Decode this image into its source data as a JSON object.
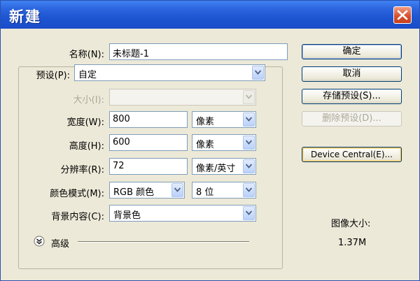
{
  "window": {
    "title": "新建"
  },
  "form": {
    "name_label": "名称(N):",
    "name_value": "未标题-1",
    "preset_label": "预设(P):",
    "preset_value": "自定",
    "size_label": "大小(I):",
    "size_value": "",
    "width_label": "宽度(W):",
    "width_value": "800",
    "width_unit": "像素",
    "height_label": "高度(H):",
    "height_value": "600",
    "height_unit": "像素",
    "resolution_label": "分辨率(R):",
    "resolution_value": "72",
    "resolution_unit": "像素/英寸",
    "color_mode_label": "颜色模式(M):",
    "color_mode_value": "RGB 颜色",
    "bit_depth_value": "8 位",
    "background_label": "背景内容(C):",
    "background_value": "背景色",
    "advanced_label": "高级"
  },
  "buttons": {
    "ok": "确定",
    "cancel": "取消",
    "save_preset": "存储预设(S)...",
    "delete_preset": "删除预设(D)...",
    "device_central": "Device Central(E)..."
  },
  "info": {
    "image_size_label": "图像大小:",
    "image_size_value": "1.37M"
  },
  "colors": {
    "title_bar": "#1e55d2",
    "close_button": "#d9502e",
    "dialog_bg": "#ece9d8",
    "field_border": "#7f9db9"
  },
  "icons": [
    "close-icon",
    "dropdown-arrow-icon",
    "expand-chevron-icon"
  ]
}
